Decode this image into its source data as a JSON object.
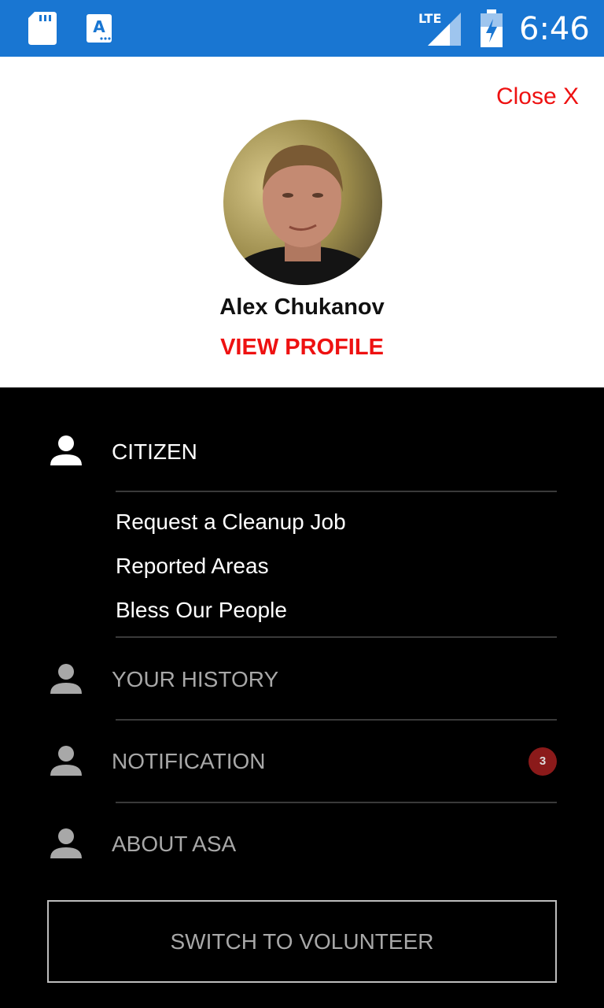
{
  "status_bar": {
    "time": "6:46",
    "network": "LTE",
    "icons": [
      "sd-card-icon",
      "keyboard-a-icon",
      "lte-signal-icon",
      "battery-charging-icon"
    ]
  },
  "header": {
    "close_label": "Close X",
    "user_name": "Alex Chukanov",
    "view_profile_label": "VIEW PROFILE"
  },
  "menu": {
    "citizen": {
      "label": "CITIZEN",
      "items": [
        "Request a Cleanup Job",
        "Reported Areas",
        "Bless Our People"
      ]
    },
    "your_history": "YOUR HISTORY",
    "notification": {
      "label": "NOTIFICATION",
      "badge_count": "3"
    },
    "about": "ABOUT ASA",
    "switch_button": "SWITCH TO VOLUNTEER"
  },
  "colors": {
    "status_bar": "#1976D2",
    "accent_red": "#EE1111",
    "menu_background": "#000000",
    "badge": "#8B1A1A"
  }
}
